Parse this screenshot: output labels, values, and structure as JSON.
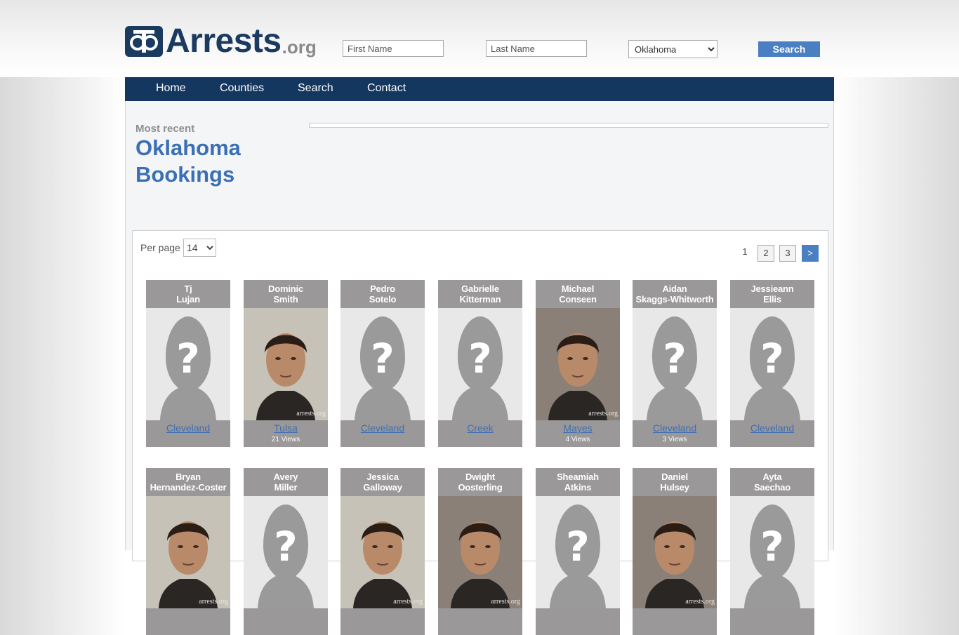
{
  "brand": {
    "name": "Arrests",
    "tld": ".org"
  },
  "search": {
    "first_placeholder": "First Name",
    "last_placeholder": "Last Name",
    "state_selected": "Oklahoma",
    "button_label": "Search"
  },
  "nav": [
    "Home",
    "Counties",
    "Search",
    "Contact"
  ],
  "heading": {
    "kicker": "Most recent",
    "line1": "Oklahoma",
    "line2": "Bookings"
  },
  "results": {
    "per_page_label": "Per page",
    "per_page_value": "14",
    "pages": [
      "1",
      "2",
      "3",
      ">"
    ]
  },
  "bookings": [
    {
      "first": "Tj",
      "last": "Lujan",
      "county": "Cleveland",
      "views": "",
      "photo": "placeholder"
    },
    {
      "first": "Dominic",
      "last": "Smith",
      "county": "Tulsa",
      "views": "21 Views",
      "photo": "mugshot"
    },
    {
      "first": "Pedro",
      "last": "Sotelo",
      "county": "Cleveland",
      "views": "",
      "photo": "placeholder"
    },
    {
      "first": "Gabrielle",
      "last": "Kitterman",
      "county": "Creek",
      "views": "",
      "photo": "placeholder"
    },
    {
      "first": "Michael",
      "last": "Conseen",
      "county": "Mayes",
      "views": "4 Views",
      "photo": "mugshot"
    },
    {
      "first": "Aidan",
      "last": "Skaggs-Whitworth",
      "county": "Cleveland",
      "views": "3 Views",
      "photo": "placeholder"
    },
    {
      "first": "Jessieann",
      "last": "Ellis",
      "county": "Cleveland",
      "views": "",
      "photo": "placeholder"
    },
    {
      "first": "Bryan",
      "last": "Hernandez-Coster",
      "county": "",
      "views": "",
      "photo": "mugshot"
    },
    {
      "first": "Avery",
      "last": "Miller",
      "county": "",
      "views": "",
      "photo": "placeholder"
    },
    {
      "first": "Jessica",
      "last": "Galloway",
      "county": "",
      "views": "",
      "photo": "mugshot"
    },
    {
      "first": "Dwight",
      "last": "Oosterling",
      "county": "",
      "views": "",
      "photo": "mugshot"
    },
    {
      "first": "Sheamiah",
      "last": "Atkins",
      "county": "",
      "views": "",
      "photo": "placeholder"
    },
    {
      "first": "Daniel",
      "last": "Hulsey",
      "county": "",
      "views": "",
      "photo": "mugshot"
    },
    {
      "first": "Ayta",
      "last": "Saechao",
      "county": "",
      "views": "",
      "photo": "placeholder"
    }
  ],
  "watermark": "arrests.org",
  "colors": {
    "navy": "#14375f",
    "accent": "#4a7fc1",
    "link": "#3a6fb5"
  }
}
